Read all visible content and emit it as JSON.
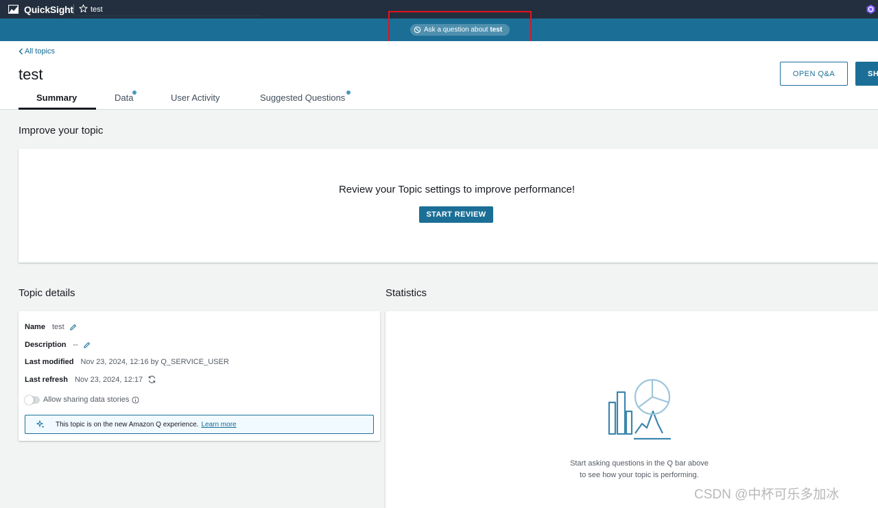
{
  "topbar": {
    "brand": "QuickSight",
    "topic_name": "test"
  },
  "qbar": {
    "prompt": "Ask a question about",
    "topic": "test"
  },
  "header": {
    "back_label": "All topics",
    "title": "test",
    "open_qa_label": "OPEN Q&A",
    "share_label": "SHARE"
  },
  "tabs": [
    {
      "label": "Summary",
      "active": true,
      "has_dot": false
    },
    {
      "label": "Data",
      "active": false,
      "has_dot": true
    },
    {
      "label": "User Activity",
      "active": false,
      "has_dot": false
    },
    {
      "label": "Suggested Questions",
      "active": false,
      "has_dot": true
    }
  ],
  "improve": {
    "heading": "Improve your topic",
    "message": "Review your Topic settings to improve performance!",
    "button": "START REVIEW"
  },
  "details": {
    "heading": "Topic details",
    "name_label": "Name",
    "name_value": "test",
    "description_label": "Description",
    "description_value": "--",
    "last_modified_label": "Last modified",
    "last_modified_value": "Nov 23, 2024, 12:16 by Q_SERVICE_USER",
    "last_refresh_label": "Last refresh",
    "last_refresh_value": "Nov 23, 2024, 12:17",
    "sharing_toggle_label": "Allow sharing data stories",
    "sharing_enabled": false,
    "info_text": "This topic is on the new Amazon Q experience.",
    "info_link": "Learn more"
  },
  "statistics": {
    "heading": "Statistics",
    "empty_line1": "Start asking questions in the Q bar above",
    "empty_line2": "to see how your topic is performing."
  },
  "watermark": "CSDN @中杯可乐多加冰",
  "colors": {
    "topbar": "#232f3e",
    "qbar": "#1b6f97",
    "primary": "#1b6f97",
    "link": "#0f6a94",
    "highlight_box": "#e8121f"
  }
}
